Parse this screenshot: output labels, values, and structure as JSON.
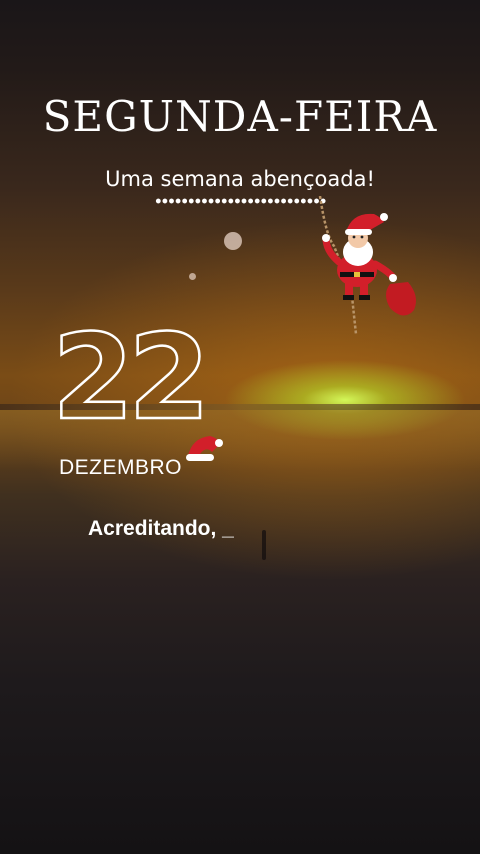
{
  "header": {
    "day_name": "SEGUNDA-FEIRA",
    "subtitle": "Uma semana abençoada!"
  },
  "date": {
    "day": "22",
    "month": "DEZEMBRO"
  },
  "caption": {
    "text": "Acreditando, _"
  },
  "colors": {
    "sun_glow": "#d6ff5c",
    "sky_orange": "#7a4c16",
    "text": "#ffffff",
    "santa_red": "#d21f2a"
  },
  "icons": {
    "santa": "santa-claus-icon",
    "hat": "santa-hat-icon"
  }
}
